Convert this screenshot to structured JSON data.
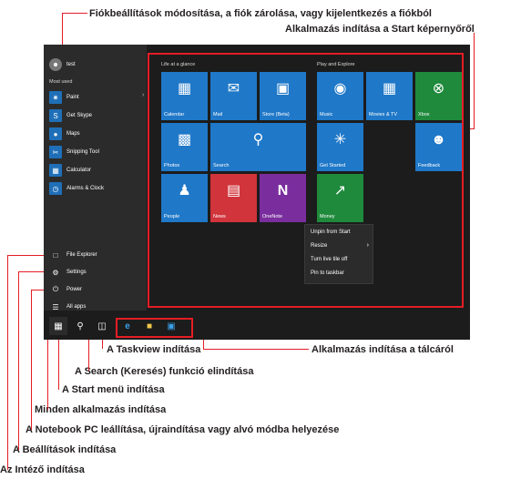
{
  "callouts": {
    "account": "Fiókbeállítások módosítása, a fiók zárolása, vagy kijelentkezés a fiókból",
    "start_screen": "Alkalmazás indítása a Start képernyőről",
    "taskview": "A Taskview indítása",
    "taskbar_apps": "Alkalmazás indítása a tálcáról",
    "search": "A Search (Keresés) funkció elindítása",
    "start_menu": "A Start menü indítása",
    "all_apps": "Minden alkalmazás indítása",
    "power": "A Notebook PC leállítása, újraindítása vagy alvó módba helyezése",
    "settings": "A Beállítások indítása",
    "explorer": "Az Intéző indítása"
  },
  "user": {
    "name": "test"
  },
  "most_used": {
    "heading": "Most used",
    "apps": [
      {
        "label": "Paint",
        "icon": "paint-icon"
      },
      {
        "label": "Get Skype",
        "icon": "skype-icon"
      },
      {
        "label": "Maps",
        "icon": "maps-icon"
      },
      {
        "label": "Snipping Tool",
        "icon": "scissors-icon"
      },
      {
        "label": "Calculator",
        "icon": "calculator-icon"
      },
      {
        "label": "Alarms & Clock",
        "icon": "alarm-clock-icon"
      }
    ]
  },
  "bottom_menu": {
    "file_explorer": "File Explorer",
    "settings": "Settings",
    "power": "Power",
    "all_apps": "All apps"
  },
  "groups": {
    "life": "Life at a glance",
    "play": "Play and Explore"
  },
  "tiles": {
    "calendar": "Calendar",
    "mail": "Mail",
    "store": "Store (Beta)",
    "photos": "Photos",
    "search": "Search",
    "people": "People",
    "news": "News",
    "onenote": "OneNote",
    "music": "Music",
    "movies": "Movies & TV",
    "xbox": "Xbox",
    "get_started": "Get Started",
    "feedback": "Feedback",
    "money": "Money"
  },
  "context_menu": {
    "unpin": "Unpin from Start",
    "resize": "Resize",
    "live_tile": "Turn live tile off",
    "pin_taskbar": "Pin to taskbar"
  },
  "colors": {
    "callout_line": "#e51d25",
    "tile_blue": "#1f78c8",
    "tile_green": "#1f8a3c",
    "tile_red": "#d1343b",
    "tile_purple": "#7a2e9e",
    "tile_light_blue": "#5aa9e6"
  }
}
